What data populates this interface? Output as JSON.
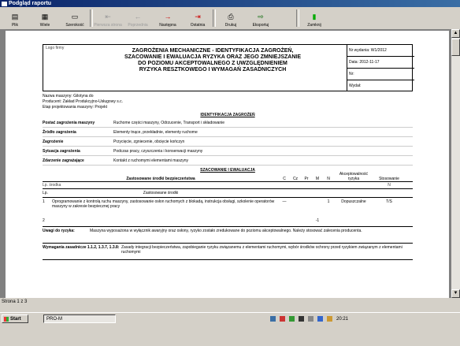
{
  "window": {
    "title": "Podgląd raportu"
  },
  "toolbar": {
    "buttons": [
      {
        "label": "Plik",
        "icon": "file-icon",
        "enabled": true
      },
      {
        "label": "Wiele",
        "icon": "pages-icon",
        "enabled": true
      },
      {
        "label": "Szerokość",
        "icon": "width-icon",
        "enabled": true
      },
      {
        "label": "Pierwsza strona",
        "icon": "first-icon",
        "enabled": false
      },
      {
        "label": "Poprzednia",
        "icon": "prev-icon",
        "enabled": false
      },
      {
        "label": "Następna",
        "icon": "next-icon",
        "enabled": true
      },
      {
        "label": "Ostatnia",
        "icon": "last-icon",
        "enabled": true
      },
      {
        "label": "Drukuj",
        "icon": "printer-icon",
        "enabled": true
      },
      {
        "label": "Eksportuj",
        "icon": "export-icon",
        "enabled": true
      },
      {
        "label": "Zamknij",
        "icon": "close-door-icon",
        "enabled": true
      }
    ]
  },
  "report": {
    "corner_label": "Logo firmy",
    "title_lines": [
      "ZAGROŻENIA MECHANICZNE - IDENTYFIKACJA ZAGROŻEŃ,",
      "SZACOWANIE I EWALUACJA RYZYKA ORAZ JEGO ZMNIEJSZANIE",
      "DO POZIOMU AKCEPTOWALNEGO Z UWZGLĘDNIENIEM",
      "RYZYKA RESZTKOWEGO I WYMAGAŃ ZASADNICZYCH"
    ],
    "meta": [
      {
        "label": "Nr wydania",
        "value": "W1/2012"
      },
      {
        "label": "Data",
        "value": "2012-11-17"
      },
      {
        "label": "Nr",
        "value": ""
      },
      {
        "label": "Wydał",
        "value": ""
      }
    ],
    "info": [
      "Nazwa maszyny: Gilotyna do",
      "Producent: Zakład Produkcyjno-Usługowy s.c.",
      "Etap projektowania maszyny: Projekt"
    ],
    "ident_title": "IDENTYFIKACJA ZAGROŻEŃ",
    "hazards": [
      {
        "key": "Postać zagrożenia maszyny",
        "value": "Ruchome części maszyny, Odrzucenie, Transport i składowanie"
      },
      {
        "key": "Źródło zagrożenia",
        "value": "Elementy tnące, przekładnie, elementy ruchome"
      },
      {
        "key": "Zagrożenie",
        "value": "Przycięcie, zgniecenie, obcięcie kończyn"
      },
      {
        "key": "Sytuacja zagrożenia",
        "value": "Podczas pracy, czyszczenia i konserwacji maszyny"
      },
      {
        "key": "Zdarzenie zagrażające",
        "value": "Kontakt z ruchomymi elementami maszyny"
      }
    ],
    "eval_title": "SZACOWANIE I EWALUACJA",
    "measures_header": "Zastosowane środki bezpieczeństwa",
    "cols": [
      "C",
      "Cz",
      "Pr",
      "M",
      "N",
      "Akceptowalność ryzyka",
      "Stosowanie"
    ],
    "measure_rows": [
      {
        "label": "Lp. środka",
        "c": "",
        "cz": "",
        "pr": "",
        "m": "",
        "n": "",
        "acc": "",
        "st": "N"
      },
      {
        "label": "Lp.",
        "c": "",
        "cz": "",
        "pr": "",
        "m": "",
        "n": "",
        "acc": "",
        "st": ""
      }
    ],
    "measure_row_label": "Zastosowane środki",
    "row1_no": "1",
    "row1_text": "Oprogramowanie z kontrolą ruchu maszyny, zastosowanie osłon ruchomych z blokadą, instrukcja obsługi, szkolenie operatorów maszyny w zakresie bezpiecznej pracy",
    "row1_vals": {
      "c": "—",
      "n": "1",
      "acc": "Dopuszczalne",
      "st": "T/S"
    },
    "row2_no": "2",
    "row2_val": "-1",
    "uwagi_label": "Uwagi do ryzyka:",
    "uwagi_text": "Maszyna wyposażona w wyłącznik awaryjny oraz osłony, ryzyko zostało zredukowane do poziomu akceptowalnego. Należy stosować zalecenia producenta.",
    "wymagania_label": "Wymagania zasadnicze 1.1.2, 1.3.7, 1.3.8:",
    "wymagania_text": "Zasady integracji bezpieczeństwa, zapobieganie ryzyku związanemu z elementami ruchomymi, wybór środków ochrony przed ryzykiem związanym z elementami ruchomymi"
  },
  "status": {
    "page": "Strona 1 z 3"
  },
  "taskbar": {
    "start": "Start",
    "task": "PRO-M",
    "clock": "20:21"
  },
  "colors": {
    "title_from": "#0a246a",
    "title_to": "#3a6ea5",
    "chrome": "#d4d0c8",
    "workspace": "#808080"
  }
}
